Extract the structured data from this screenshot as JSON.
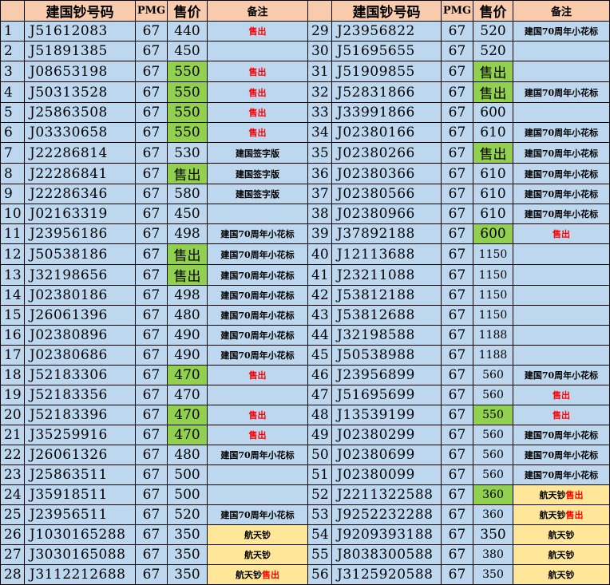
{
  "header": {
    "code_label": "建国钞号码",
    "grade_label": "PMG",
    "price_label": "售价",
    "note_label": "备注"
  },
  "colors": {
    "header_bg": "#f8cbad",
    "row_bg": "#bdd7ee",
    "highlight_green": "#92d050",
    "highlight_yellow": "#ffe699",
    "sold_text": "#ff0000"
  },
  "left_rows": [
    {
      "no": "1",
      "code": "J51612083",
      "pmg": "67",
      "price": "440",
      "note": "售出",
      "note_style": "red"
    },
    {
      "no": "2",
      "code": "J51891385",
      "pmg": "67",
      "price": "450",
      "note": ""
    },
    {
      "no": "3",
      "code": "J08653198",
      "pmg": "67",
      "price": "550",
      "price_style": "green",
      "note": "售出",
      "note_style": "red"
    },
    {
      "no": "4",
      "code": "J50313528",
      "pmg": "67",
      "price": "550",
      "price_style": "green",
      "note": "售出",
      "note_style": "red"
    },
    {
      "no": "5",
      "code": "J25863508",
      "pmg": "67",
      "price": "550",
      "price_style": "green",
      "note": "售出",
      "note_style": "red"
    },
    {
      "no": "6",
      "code": "J03330658",
      "pmg": "67",
      "price": "550",
      "price_style": "green",
      "note": "售出",
      "note_style": "red"
    },
    {
      "no": "7",
      "code": "J22286814",
      "pmg": "67",
      "price": "530",
      "note": "建国签字版"
    },
    {
      "no": "8",
      "code": "J22286841",
      "pmg": "67",
      "price": "售出",
      "price_style": "green-red",
      "note": "建国签字版"
    },
    {
      "no": "9",
      "code": "J22286346",
      "pmg": "67",
      "price": "580",
      "note": "建国签字版"
    },
    {
      "no": "10",
      "code": "J02163319",
      "pmg": "67",
      "price": "450",
      "note": ""
    },
    {
      "no": "11",
      "code": "J23956186",
      "pmg": "67",
      "price": "498",
      "note": "建国70周年小花标"
    },
    {
      "no": "12",
      "code": "J50538186",
      "pmg": "67",
      "price": "售出",
      "price_style": "green-red",
      "note": "建国70周年小花标"
    },
    {
      "no": "13",
      "code": "J32198656",
      "pmg": "67",
      "price": "售出",
      "price_style": "green-red",
      "note": "建国70周年小花标"
    },
    {
      "no": "14",
      "code": "J02380186",
      "pmg": "67",
      "price": "498",
      "note": "建国70周年小花标"
    },
    {
      "no": "15",
      "code": "J26061396",
      "pmg": "67",
      "price": "480",
      "note": "建国70周年小花标"
    },
    {
      "no": "16",
      "code": "J02380896",
      "pmg": "67",
      "price": "490",
      "note": "建国70周年小花标"
    },
    {
      "no": "17",
      "code": "J02380686",
      "pmg": "67",
      "price": "490",
      "note": "建国70周年小花标"
    },
    {
      "no": "18",
      "code": "J52183306",
      "pmg": "67",
      "price": "470",
      "price_style": "green",
      "note": "售出",
      "note_style": "red"
    },
    {
      "no": "19",
      "code": "J52183356",
      "pmg": "67",
      "price": "470",
      "note": ""
    },
    {
      "no": "20",
      "code": "J52183396",
      "pmg": "67",
      "price": "470",
      "price_style": "green",
      "note": "售出",
      "note_style": "red"
    },
    {
      "no": "21",
      "code": "J35259916",
      "pmg": "67",
      "price": "470",
      "price_style": "green",
      "note": "售出",
      "note_style": "red"
    },
    {
      "no": "22",
      "code": "J26061326",
      "pmg": "67",
      "price": "480",
      "note": "建国70周年小花标"
    },
    {
      "no": "23",
      "code": "J25863511",
      "pmg": "67",
      "price": "500",
      "note": ""
    },
    {
      "no": "24",
      "code": "J35918511",
      "pmg": "67",
      "price": "500",
      "note": ""
    },
    {
      "no": "25",
      "code": "J23956511",
      "pmg": "67",
      "price": "520",
      "note": "建国70周年小花标"
    },
    {
      "no": "26",
      "code": "J1030165288",
      "pmg": "67",
      "price": "350",
      "note": "航天钞",
      "note_bg": "yellow"
    },
    {
      "no": "27",
      "code": "J3030165088",
      "pmg": "67",
      "price": "350",
      "note": "航天钞",
      "note_bg": "yellow"
    },
    {
      "no": "28",
      "code": "J3112212688",
      "pmg": "67",
      "price": "350",
      "note": "航天钞",
      "note_suffix": "售出",
      "note_bg": "yellow"
    }
  ],
  "right_rows": [
    {
      "no": "29",
      "code": "J23956822",
      "pmg": "67",
      "price": "520",
      "note": "建国70周年小花标"
    },
    {
      "no": "30",
      "code": "J51695655",
      "pmg": "67",
      "price": "520",
      "note": ""
    },
    {
      "no": "31",
      "code": "J51909855",
      "pmg": "67",
      "price": "售出",
      "price_style": "green-red",
      "note": ""
    },
    {
      "no": "32",
      "code": "J52831866",
      "pmg": "67",
      "price": "售出",
      "price_style": "green-red",
      "note": "建国70周年小花标"
    },
    {
      "no": "33",
      "code": "J33991866",
      "pmg": "67",
      "price": "600",
      "note": ""
    },
    {
      "no": "34",
      "code": "J02380166",
      "pmg": "67",
      "price": "610",
      "note": "建国70周年小花标"
    },
    {
      "no": "35",
      "code": "J02380266",
      "pmg": "67",
      "price": "售出",
      "price_style": "green-red",
      "note": "建国70周年小花标"
    },
    {
      "no": "36",
      "code": "J02380366",
      "pmg": "67",
      "price": "610",
      "note": "建国70周年小花标"
    },
    {
      "no": "37",
      "code": "J02380566",
      "pmg": "67",
      "price": "610",
      "note": "建国70周年小花标"
    },
    {
      "no": "38",
      "code": "J02380966",
      "pmg": "67",
      "price": "610",
      "note": "建国70周年小花标"
    },
    {
      "no": "39",
      "code": "J37892188",
      "pmg": "67",
      "price": "600",
      "price_style": "green",
      "note": "售出",
      "note_style": "red"
    },
    {
      "no": "40",
      "code": "J12113688",
      "pmg": "67",
      "price": "1150",
      "price_style": "small",
      "note": ""
    },
    {
      "no": "41",
      "code": "J23211088",
      "pmg": "67",
      "price": "1150",
      "price_style": "small",
      "note": ""
    },
    {
      "no": "42",
      "code": "J53812188",
      "pmg": "67",
      "price": "1150",
      "price_style": "small",
      "note": ""
    },
    {
      "no": "43",
      "code": "J53812688",
      "pmg": "67",
      "price": "1150",
      "price_style": "small",
      "note": ""
    },
    {
      "no": "44",
      "code": "J32198588",
      "pmg": "67",
      "price": "1188",
      "price_style": "small",
      "note": ""
    },
    {
      "no": "45",
      "code": "J50538988",
      "pmg": "67",
      "price": "1188",
      "price_style": "small",
      "note": ""
    },
    {
      "no": "46",
      "code": "J23956899",
      "pmg": "67",
      "price": "560",
      "price_style": "small",
      "note": "建国70周年小花标"
    },
    {
      "no": "47",
      "code": "J51695699",
      "pmg": "67",
      "price": "560",
      "price_style": "small",
      "note": "售出",
      "note_style": "red"
    },
    {
      "no": "48",
      "code": "J13539199",
      "pmg": "67",
      "price": "550",
      "price_style": "green-small",
      "note": "售出",
      "note_style": "red"
    },
    {
      "no": "49",
      "code": "J02380299",
      "pmg": "67",
      "price": "560",
      "price_style": "small",
      "note": "建国70周年小花标"
    },
    {
      "no": "50",
      "code": "J02380699",
      "pmg": "67",
      "price": "560",
      "price_style": "small",
      "note": "建国70周年小花标"
    },
    {
      "no": "51",
      "code": "J02380099",
      "pmg": "67",
      "price": "560",
      "price_style": "small",
      "note": "建国70周年小花标"
    },
    {
      "no": "52",
      "code": "J2211322588",
      "pmg": "67",
      "price": "360",
      "price_style": "green-small",
      "note": "航天钞",
      "note_suffix": "售出",
      "note_bg": "yellow"
    },
    {
      "no": "53",
      "code": "J9252232288",
      "pmg": "67",
      "price": "360",
      "price_style": "small",
      "note": "航天钞",
      "note_suffix": "售出",
      "note_bg": "yellow"
    },
    {
      "no": "54",
      "code": "J9209393188",
      "pmg": "67",
      "price": "350",
      "note": "航天钞",
      "note_bg": "yellow"
    },
    {
      "no": "55",
      "code": "J8038300588",
      "pmg": "67",
      "price": "380",
      "price_style": "small",
      "note": "航天钞",
      "note_bg": "yellow"
    },
    {
      "no": "56",
      "code": "J3125920588",
      "pmg": "67",
      "price": "350",
      "price_style": "small",
      "note": "航天钞",
      "note_bg": "yellow"
    }
  ]
}
